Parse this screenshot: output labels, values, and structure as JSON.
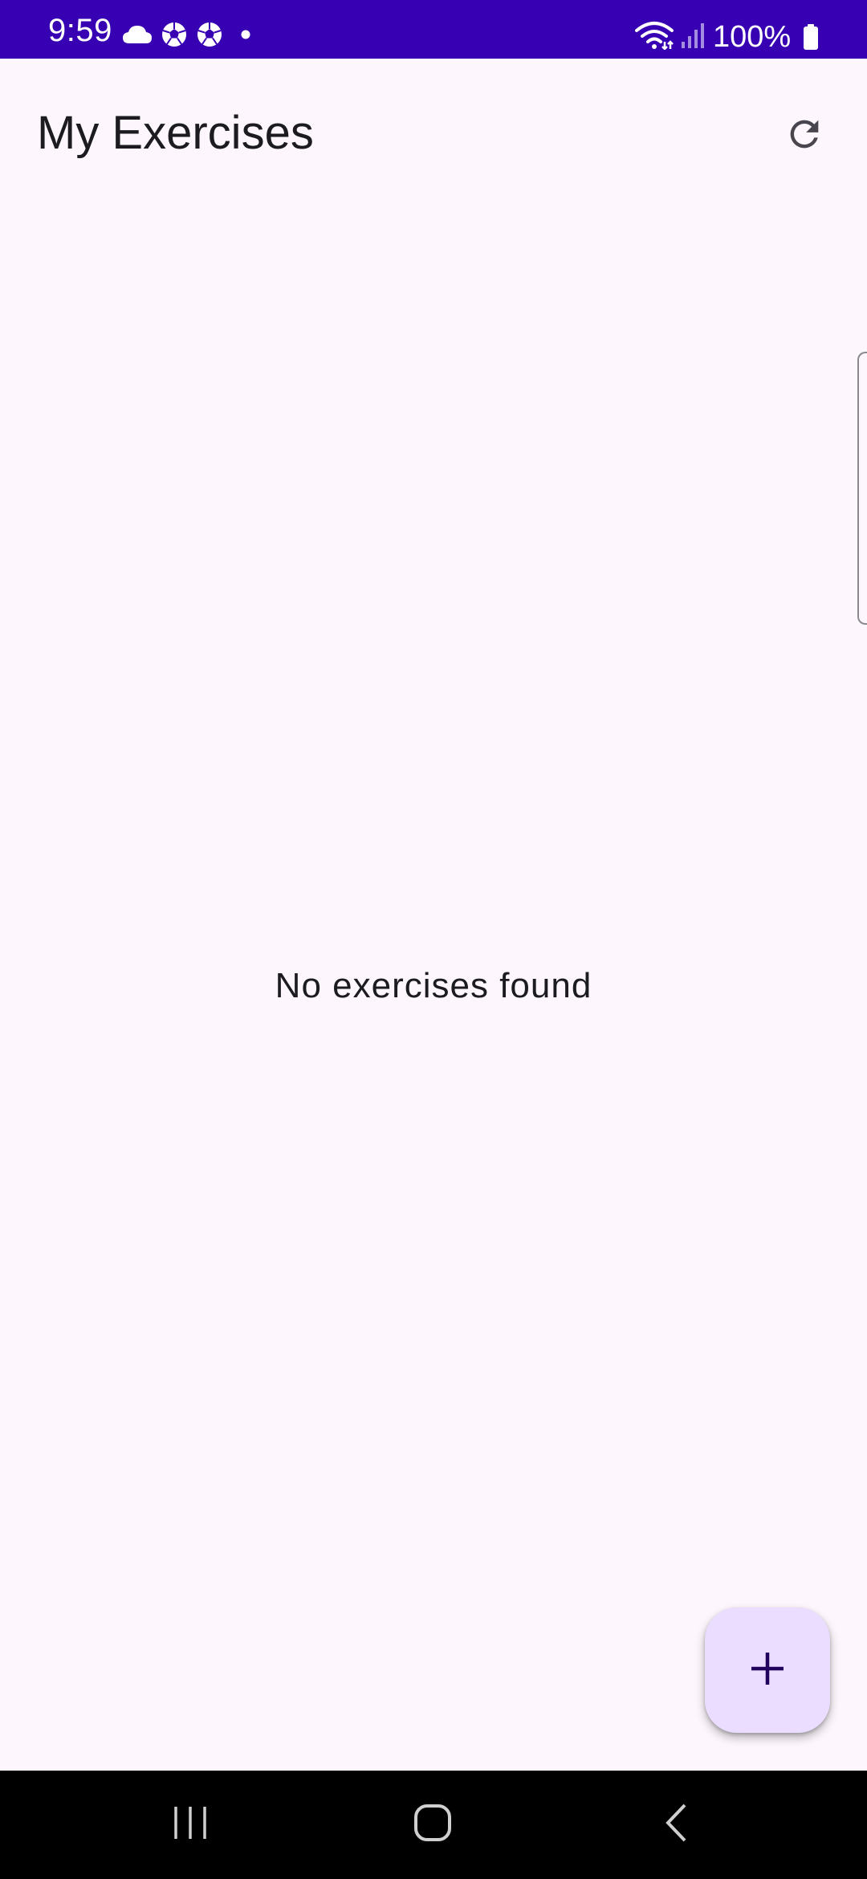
{
  "status_bar": {
    "time": "9:59",
    "battery": "100%",
    "background_color": "#3700b3",
    "icons": [
      "cloud-icon",
      "soccer-ball-icon",
      "soccer-ball-icon",
      "dot-icon",
      "wifi-icon",
      "signal-icon",
      "battery-icon"
    ]
  },
  "app_bar": {
    "title": "My Exercises",
    "refresh_icon": "refresh-icon"
  },
  "main": {
    "empty_message": "No exercises found"
  },
  "fab": {
    "icon": "plus-icon",
    "color": "#eaddff",
    "icon_color": "#21005d"
  },
  "nav_bar": {
    "buttons": [
      "recents-icon",
      "home-icon",
      "back-icon"
    ]
  },
  "colors": {
    "background": "#fdf7fd",
    "text": "#1c1b1f"
  }
}
